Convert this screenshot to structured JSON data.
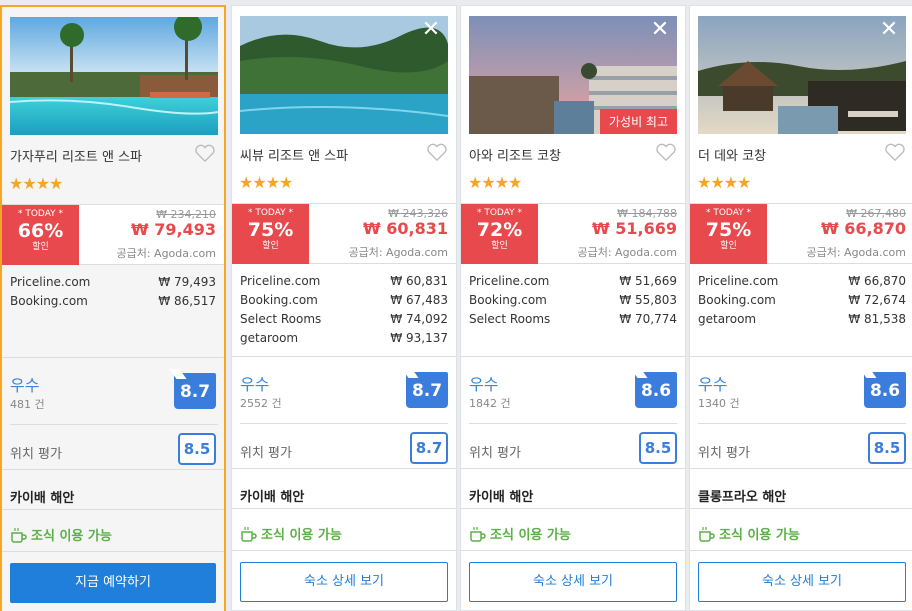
{
  "colors": {
    "accent": "#1f7fdb",
    "deal": "#e8494c",
    "star": "#f5a623",
    "breakfast": "#5bb046",
    "selected_border": "#f5a623"
  },
  "cards": [
    {
      "name": "가자푸리 리조트 앤 스파",
      "stars": "★★★★",
      "ribbon": "",
      "today": "* TODAY *",
      "discount": "66%",
      "discount_label": "할인",
      "original_price": "₩ 234,210",
      "price": "₩ 79,493",
      "supplier": "공급처: Agoda.com",
      "others": [
        {
          "site": "Priceline.com",
          "price": "₩  79,493"
        },
        {
          "site": "Booking.com",
          "price": "₩  86,517"
        }
      ],
      "rating_label": "우수",
      "review_count": "481 건",
      "score": "8.7",
      "location_label": "위치 평가",
      "location_score": "8.5",
      "area": "카이배 해안",
      "breakfast": "조식 이용 가능",
      "button": "지금 예약하기"
    },
    {
      "name": "씨뷰 리조트 앤 스파",
      "stars": "★★★★",
      "ribbon": "",
      "today": "* TODAY *",
      "discount": "75%",
      "discount_label": "할인",
      "original_price": "₩ 243,326",
      "price": "₩ 60,831",
      "supplier": "공급처: Agoda.com",
      "others": [
        {
          "site": "Priceline.com",
          "price": "₩  60,831"
        },
        {
          "site": "Booking.com",
          "price": "₩  67,483"
        },
        {
          "site": "Select Rooms",
          "price": "₩  74,092"
        },
        {
          "site": "getaroom",
          "price": "₩  93,137"
        }
      ],
      "rating_label": "우수",
      "review_count": "2552 건",
      "score": "8.7",
      "location_label": "위치 평가",
      "location_score": "8.7",
      "area": "카이배 해안",
      "breakfast": "조식 이용 가능",
      "button": "숙소 상세 보기"
    },
    {
      "name": "아와 리조트 코창",
      "stars": "★★★★",
      "ribbon": "가성비 최고",
      "today": "* TODAY *",
      "discount": "72%",
      "discount_label": "할인",
      "original_price": "₩ 184,788",
      "price": "₩ 51,669",
      "supplier": "공급처: Agoda.com",
      "others": [
        {
          "site": "Priceline.com",
          "price": "₩  51,669"
        },
        {
          "site": "Booking.com",
          "price": "₩  55,803"
        },
        {
          "site": "Select Rooms",
          "price": "₩  70,774"
        }
      ],
      "rating_label": "우수",
      "review_count": "1842 건",
      "score": "8.6",
      "location_label": "위치 평가",
      "location_score": "8.5",
      "area": "카이배 해안",
      "breakfast": "조식 이용 가능",
      "button": "숙소 상세 보기"
    },
    {
      "name": "더 데와 코창",
      "stars": "★★★★",
      "ribbon": "",
      "today": "* TODAY *",
      "discount": "75%",
      "discount_label": "할인",
      "original_price": "₩ 267,480",
      "price": "₩ 66,870",
      "supplier": "공급처: Agoda.com",
      "others": [
        {
          "site": "Priceline.com",
          "price": "₩  66,870"
        },
        {
          "site": "Booking.com",
          "price": "₩  72,674"
        },
        {
          "site": "getaroom",
          "price": "₩  81,538"
        }
      ],
      "rating_label": "우수",
      "review_count": "1340 건",
      "score": "8.6",
      "location_label": "위치 평가",
      "location_score": "8.5",
      "area": "클롱프라오 해안",
      "breakfast": "조식 이용 가능",
      "button": "숙소 상세 보기"
    }
  ],
  "close_glyph": "✕"
}
